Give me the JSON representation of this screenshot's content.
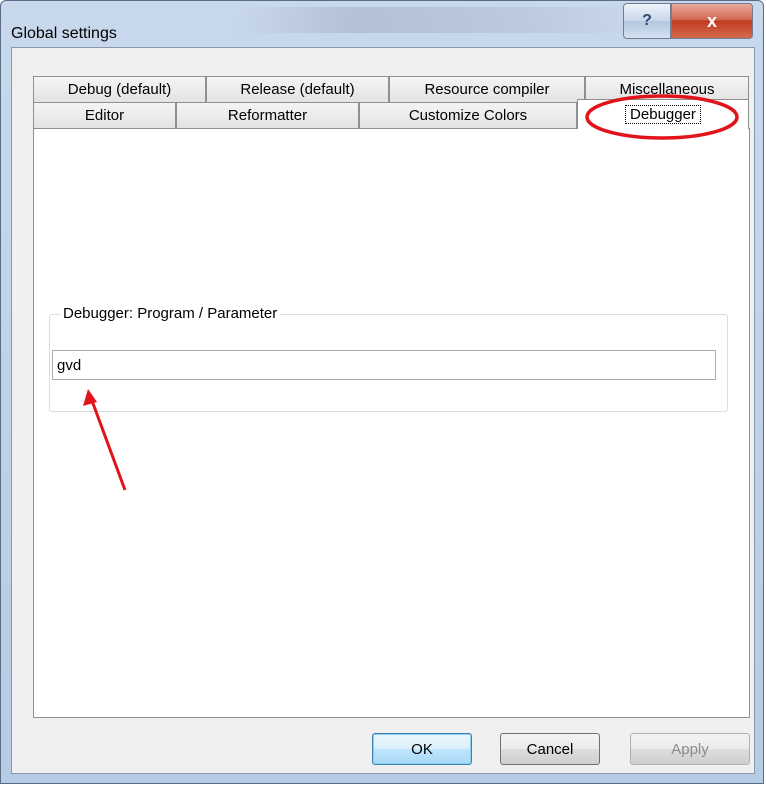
{
  "window": {
    "title": "Global settings",
    "help_button": "?",
    "close_button": "x"
  },
  "tabs": {
    "row_top": [
      {
        "label": "Debug (default)"
      },
      {
        "label": "Release (default)"
      },
      {
        "label": "Resource compiler"
      },
      {
        "label": "Miscellaneous"
      }
    ],
    "row_bottom": [
      {
        "label": "Editor"
      },
      {
        "label": "Reformatter"
      },
      {
        "label": "Customize Colors"
      },
      {
        "label": "Debugger",
        "active": true
      }
    ]
  },
  "debugger": {
    "group_label": "Debugger: Program / Parameter",
    "program_value": "gvd"
  },
  "buttons": {
    "ok": "OK",
    "cancel": "Cancel",
    "apply": "Apply"
  },
  "colors": {
    "annotation": "#e0141a",
    "ok_border": "#3c7fb1"
  }
}
